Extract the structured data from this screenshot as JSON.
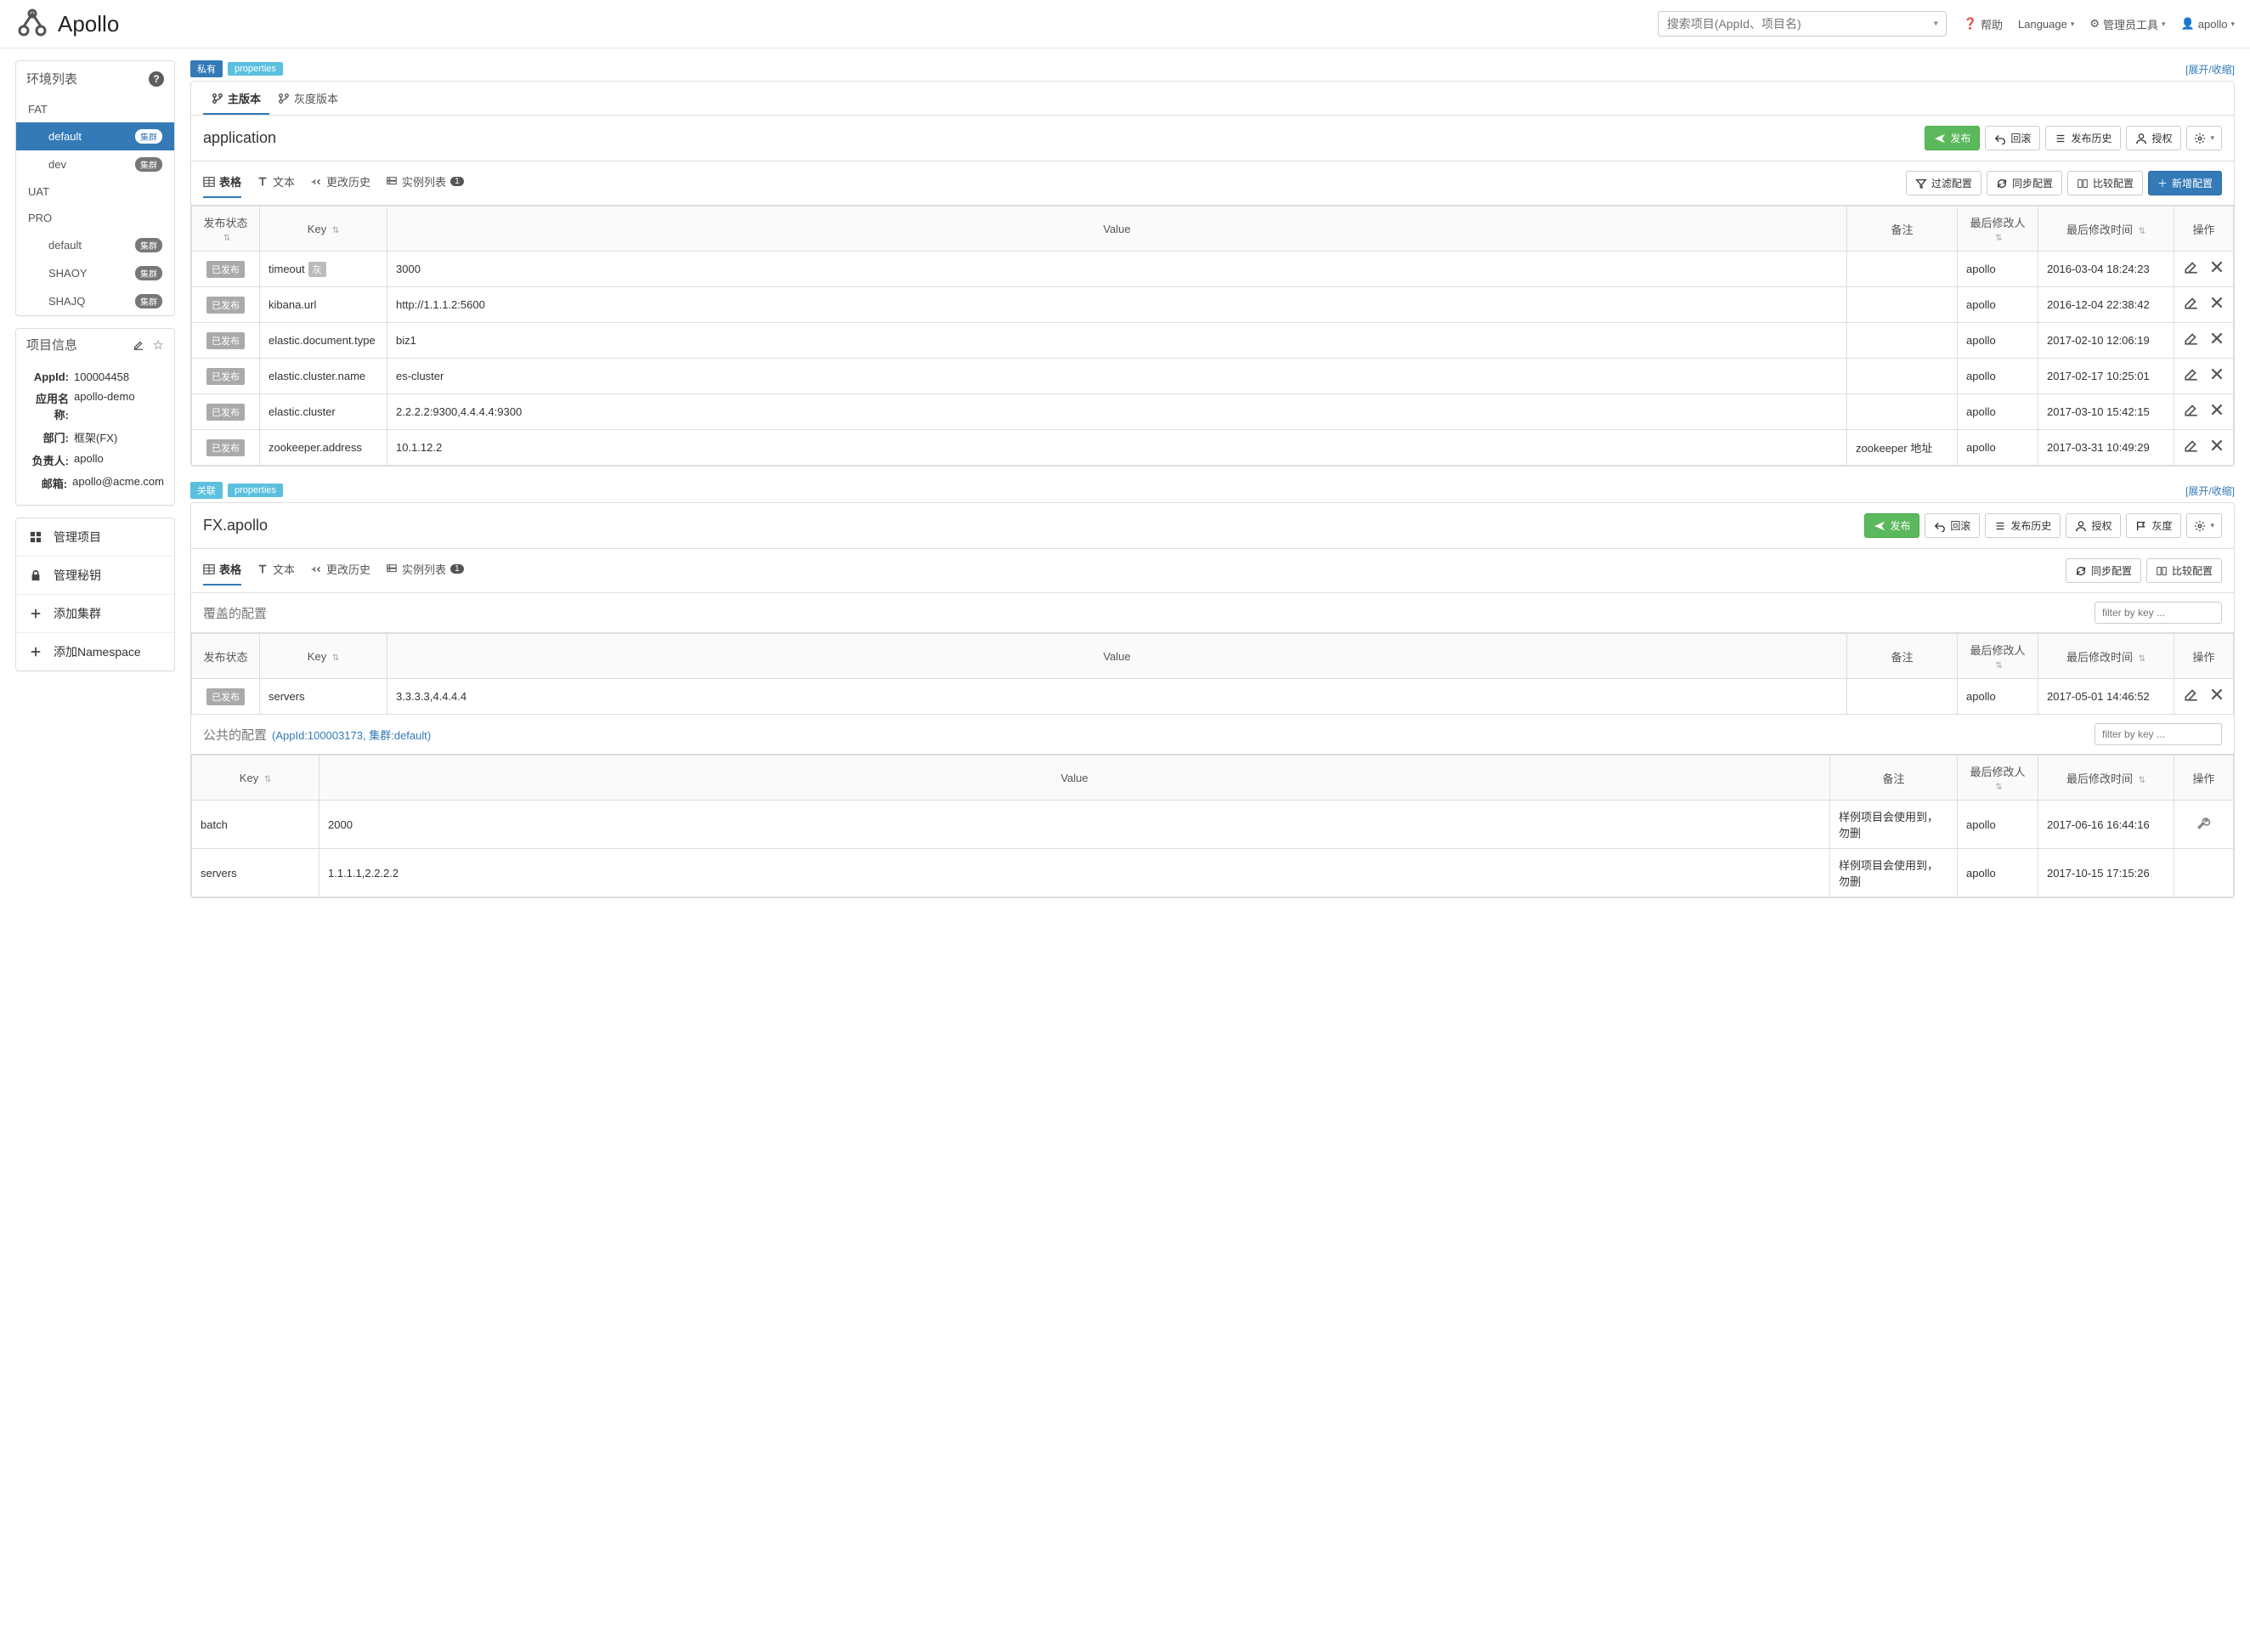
{
  "brand": "Apollo",
  "search_placeholder": "搜索项目(AppId、项目名)",
  "nav": {
    "help": "帮助",
    "language": "Language",
    "admin_tools": "管理员工具",
    "user": "apollo"
  },
  "env_panel": {
    "title": "环境列表",
    "cluster_badge": "集群",
    "groups": [
      {
        "name": "FAT",
        "clusters": [
          {
            "name": "default",
            "active": true
          },
          {
            "name": "dev"
          }
        ]
      },
      {
        "name": "UAT",
        "clusters": []
      },
      {
        "name": "PRO",
        "clusters": [
          {
            "name": "default"
          },
          {
            "name": "SHAOY"
          },
          {
            "name": "SHAJQ"
          }
        ]
      }
    ]
  },
  "project_info": {
    "title": "项目信息",
    "labels": {
      "appid": "AppId:",
      "appname": "应用名称:",
      "dept": "部门:",
      "owner": "负责人:",
      "email": "邮箱:"
    },
    "values": {
      "appid": "100004458",
      "appname": "apollo-demo",
      "dept": "框架(FX)",
      "owner": "apollo",
      "email": "apollo@acme.com"
    }
  },
  "side_links": [
    {
      "icon": "grid",
      "label": "管理项目"
    },
    {
      "icon": "lock",
      "label": "管理秘钥"
    },
    {
      "icon": "plus",
      "label": "添加集群"
    },
    {
      "icon": "plus",
      "label": "添加Namespace"
    }
  ],
  "labels": {
    "toggle": "[展开/收缩]",
    "main_version": "主版本",
    "gray_version": "灰度版本",
    "publish": "发布",
    "rollback": "回滚",
    "history": "发布历史",
    "auth": "授权",
    "gray": "灰度",
    "filter_conf": "过滤配置",
    "sync_conf": "同步配置",
    "compare_conf": "比较配置",
    "add_conf": "新增配置",
    "tab_table": "表格",
    "tab_text": "文本",
    "tab_changes": "更改历史",
    "tab_instances": "实例列表",
    "instance_count": "1",
    "col_status": "发布状态",
    "col_key": "Key",
    "col_value": "Value",
    "col_note": "备注",
    "col_modifier": "最后修改人",
    "col_modtime": "最后修改时间",
    "col_ops": "操作",
    "published": "已发布",
    "gray_badge": "灰",
    "override_section": "覆盖的配置",
    "public_section": "公共的配置",
    "public_sub": "(AppId:100003173, 集群:default)",
    "filter_placeholder": "filter by key ..."
  },
  "namespaces": [
    {
      "tag_type": "private",
      "tag_type_label": "私有",
      "tag_format": "properties",
      "name": "application",
      "has_gray_tab": true,
      "show_top_actions": true,
      "actions": [
        "publish",
        "rollback",
        "history",
        "auth",
        "gear"
      ],
      "sub_actions_full": true,
      "rows": [
        {
          "status": "已发布",
          "key": "timeout",
          "gray": true,
          "value": "3000",
          "note": "",
          "modifier": "apollo",
          "modtime": "2016-03-04 18:24:23"
        },
        {
          "status": "已发布",
          "key": "kibana.url",
          "value": "http://1.1.1.2:5600",
          "note": "",
          "modifier": "apollo",
          "modtime": "2016-12-04 22:38:42"
        },
        {
          "status": "已发布",
          "key": "elastic.document.type",
          "value": "biz1",
          "note": "",
          "modifier": "apollo",
          "modtime": "2017-02-10 12:06:19"
        },
        {
          "status": "已发布",
          "key": "elastic.cluster.name",
          "value": "es-cluster",
          "note": "",
          "modifier": "apollo",
          "modtime": "2017-02-17 10:25:01"
        },
        {
          "status": "已发布",
          "key": "elastic.cluster",
          "value": "2.2.2.2:9300,4.4.4.4:9300",
          "note": "",
          "modifier": "apollo",
          "modtime": "2017-03-10 15:42:15"
        },
        {
          "status": "已发布",
          "key": "zookeeper.address",
          "value": "10.1.12.2",
          "note": "zookeeper 地址",
          "modifier": "apollo",
          "modtime": "2017-03-31 10:49:29"
        }
      ]
    },
    {
      "tag_type": "assoc",
      "tag_type_label": "关联",
      "tag_format": "properties",
      "name": "FX.apollo",
      "has_gray_tab": false,
      "show_top_actions": true,
      "actions": [
        "publish",
        "rollback",
        "history",
        "auth",
        "gray",
        "gear"
      ],
      "sub_actions_full": false,
      "override_rows": [
        {
          "status": "已发布",
          "key": "servers",
          "value": "3.3.3.3,4.4.4.4",
          "note": "",
          "modifier": "apollo",
          "modtime": "2017-05-01 14:46:52"
        }
      ],
      "public_rows": [
        {
          "key": "batch",
          "value": "2000",
          "note": "样例项目会使用到，勿删",
          "modifier": "apollo",
          "modtime": "2017-06-16 16:44:16",
          "tool": true
        },
        {
          "key": "servers",
          "value": "1.1.1.1,2.2.2.2",
          "note": "样例项目会使用到，勿删",
          "modifier": "apollo",
          "modtime": "2017-10-15 17:15:26",
          "tool": false
        }
      ]
    }
  ]
}
